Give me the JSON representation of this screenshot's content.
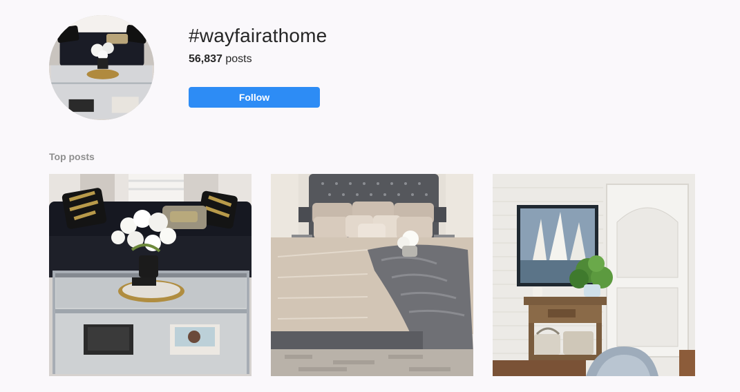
{
  "hashtag": {
    "title": "#wayfairathome",
    "post_count": "56,837",
    "post_count_suffix": " posts",
    "follow_label": "Follow",
    "accent_color": "#2d8cf5"
  },
  "avatar": {
    "icon": "living-room-photo"
  },
  "top_posts": {
    "label": "Top posts",
    "items": [
      {
        "icon": "living-room-photo"
      },
      {
        "icon": "bedroom-photo"
      },
      {
        "icon": "entryway-photo"
      }
    ]
  }
}
